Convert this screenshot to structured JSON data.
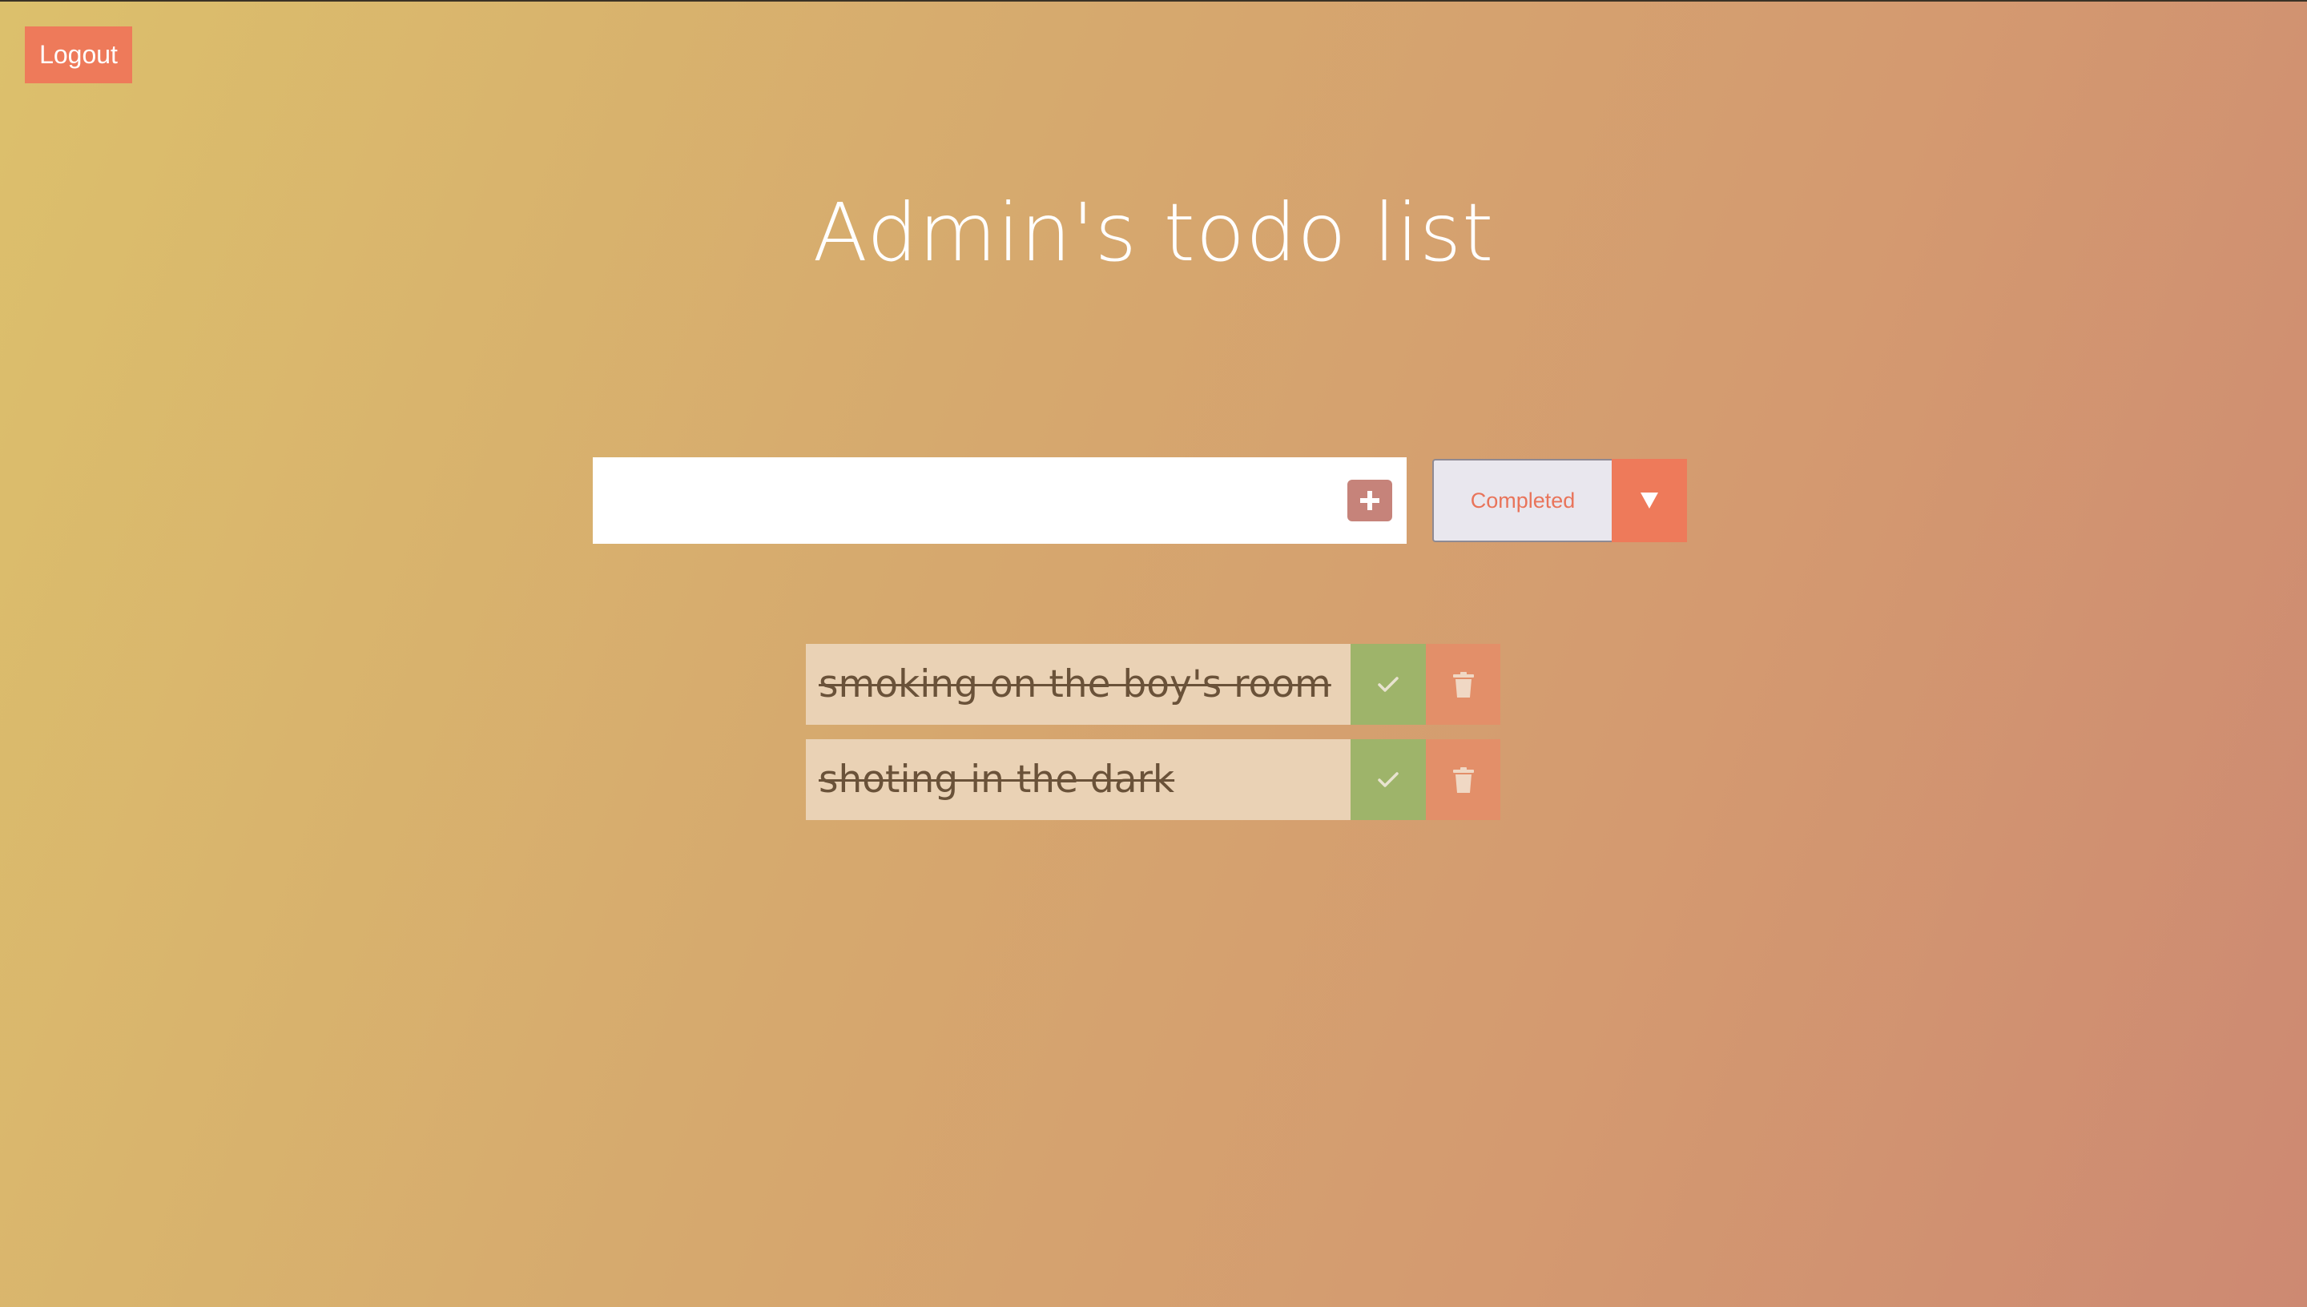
{
  "header": {
    "logout_label": "Logout"
  },
  "main": {
    "title": "Admin's todo list",
    "new_todo": {
      "value": "",
      "placeholder": "",
      "add_icon": "plus-icon"
    },
    "filter": {
      "selected": "Completed",
      "options": [
        "Completed"
      ],
      "arrow_icon": "triangle-down-icon"
    },
    "todos": [
      {
        "text": "smoking on the boy's room",
        "completed": true,
        "check_icon": "check-icon",
        "delete_icon": "trash-icon"
      },
      {
        "text": "shoting in the dark",
        "completed": true,
        "check_icon": "check-icon",
        "delete_icon": "trash-icon"
      }
    ]
  },
  "colors": {
    "accent": "#ee7a5a",
    "complete": "#9eb46a",
    "delete": "#e38f69",
    "todo_bg": "#ead2b5",
    "todo_text": "#6a5239",
    "add_button": "#c6837a"
  }
}
